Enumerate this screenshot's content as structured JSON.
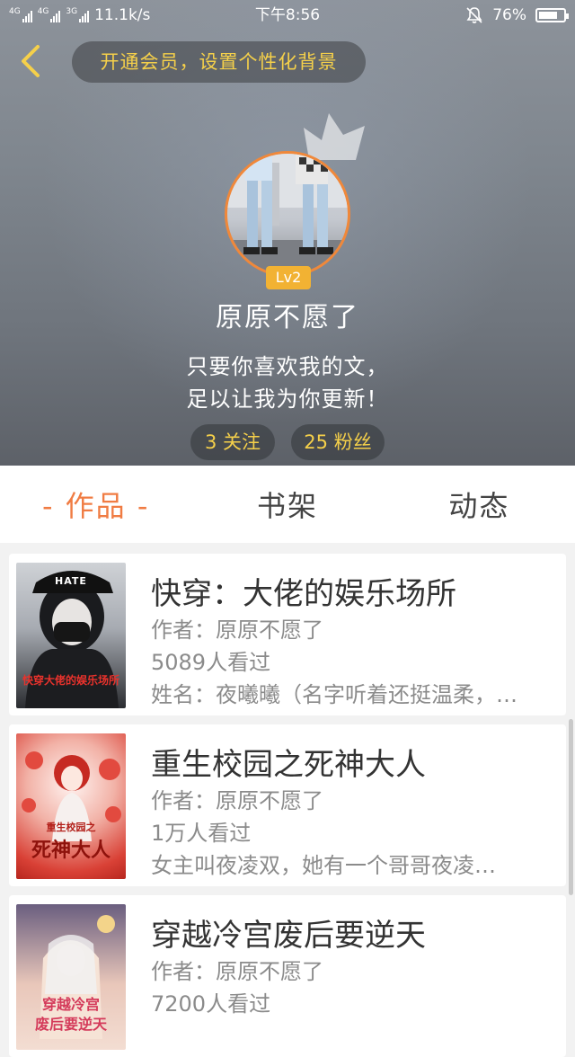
{
  "status_bar": {
    "signal_1": "4G",
    "signal_2": "4G",
    "signal_3": "3G",
    "speed": "11.1k/s",
    "time": "下午8:56",
    "battery": "76%",
    "battery_level": 0.76
  },
  "header": {
    "vip_banner": "开通会员，设置个性化背景",
    "level": "Lv2",
    "username": "原原不愿了",
    "bio_line1": "只要你喜欢我的文，",
    "bio_line2": "足以让我为你更新！",
    "following": "3 关注",
    "fans": "25 粉丝"
  },
  "tabs": [
    {
      "label": "- 作品 -",
      "active": true
    },
    {
      "label": "书架",
      "active": false
    },
    {
      "label": "动态",
      "active": false
    }
  ],
  "books": [
    {
      "title": "快穿：大佬的娱乐场所",
      "author": "作者：原原不愿了",
      "views": "5089人看过",
      "description": "姓名：夜曦曦（名字听着还挺温柔，…",
      "cover_text": "快穿大佬的娱乐场所",
      "cover_label": "HATE"
    },
    {
      "title": "重生校园之死神大人",
      "author": "作者：原原不愿了",
      "views": "1万人看过",
      "description": "女主叫夜凌双，她有一个哥哥夜凌…",
      "cover_text": "重生校园之",
      "cover_title": "死神大人"
    },
    {
      "title": "穿越冷宫废后要逆天",
      "author": "作者：原原不愿了",
      "views": "7200人看过",
      "description": "",
      "cover_text": "穿越冷宫",
      "cover_title": "废后要逆天"
    }
  ]
}
